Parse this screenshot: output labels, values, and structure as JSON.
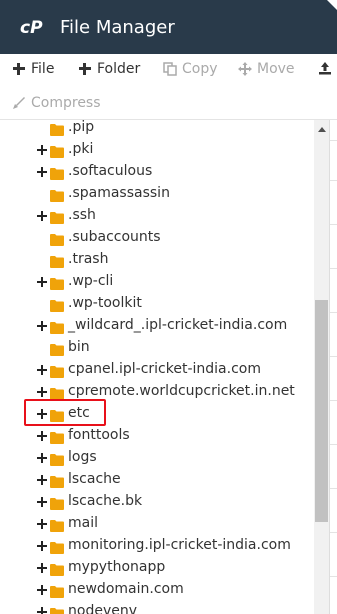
{
  "app": {
    "title": "File Manager",
    "header_color": "#293a4a",
    "accent_folder_color": "#f0a30a"
  },
  "toolbar": {
    "file_label": "File",
    "folder_label": "Folder",
    "copy_label": "Copy",
    "move_label": "Move",
    "compress_label": "Compress"
  },
  "tree": {
    "items": [
      {
        "label": ".pip",
        "expandable": false
      },
      {
        "label": ".pki",
        "expandable": true
      },
      {
        "label": ".softaculous",
        "expandable": true
      },
      {
        "label": ".spamassassin",
        "expandable": false
      },
      {
        "label": ".ssh",
        "expandable": true
      },
      {
        "label": ".subaccounts",
        "expandable": false
      },
      {
        "label": ".trash",
        "expandable": false
      },
      {
        "label": ".wp-cli",
        "expandable": true
      },
      {
        "label": ".wp-toolkit",
        "expandable": false
      },
      {
        "label": "_wildcard_.ipl-cricket-india.com",
        "expandable": true
      },
      {
        "label": "bin",
        "expandable": false
      },
      {
        "label": "cpanel.ipl-cricket-india.com",
        "expandable": true
      },
      {
        "label": "cpremote.worldcupcricket.in.net",
        "expandable": true
      },
      {
        "label": "etc",
        "expandable": true,
        "highlighted": true
      },
      {
        "label": "fonttools",
        "expandable": true
      },
      {
        "label": "logs",
        "expandable": true
      },
      {
        "label": "lscache",
        "expandable": true
      },
      {
        "label": "lscache.bk",
        "expandable": true
      },
      {
        "label": "mail",
        "expandable": true
      },
      {
        "label": "monitoring.ipl-cricket-india.com",
        "expandable": true
      },
      {
        "label": "mypythonapp",
        "expandable": true
      },
      {
        "label": "newdomain.com",
        "expandable": true
      },
      {
        "label": "nodevenv",
        "expandable": true
      }
    ]
  }
}
